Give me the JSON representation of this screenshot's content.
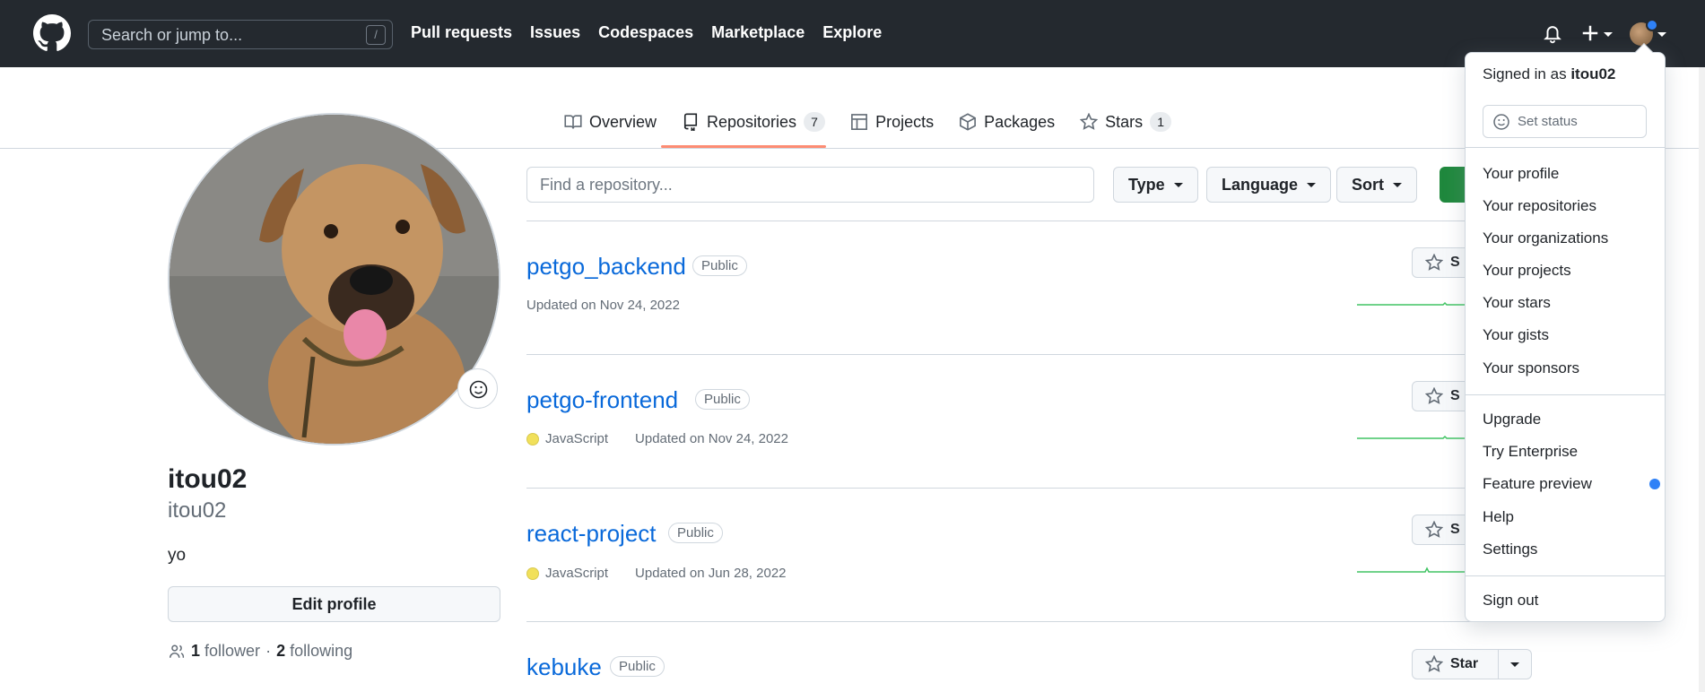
{
  "header": {
    "search_placeholder": "Search or jump to...",
    "search_shortcut": "/",
    "nav": [
      "Pull requests",
      "Issues",
      "Codespaces",
      "Marketplace",
      "Explore"
    ]
  },
  "tabs": [
    {
      "label": "Overview",
      "icon": "book-icon"
    },
    {
      "label": "Repositories",
      "icon": "repo-icon",
      "count": "7"
    },
    {
      "label": "Projects",
      "icon": "table-icon"
    },
    {
      "label": "Packages",
      "icon": "package-icon"
    },
    {
      "label": "Stars",
      "icon": "star-icon",
      "count": "1"
    }
  ],
  "profile": {
    "name": "itou02",
    "login": "itou02",
    "bio": "yo",
    "edit_label": "Edit profile",
    "followers": "1",
    "followers_label": "follower",
    "sep": "·",
    "following": "2",
    "following_label": "following"
  },
  "repo_filter": {
    "placeholder": "Find a repository...",
    "type": "Type",
    "language": "Language",
    "sort": "Sort"
  },
  "repos": [
    {
      "name": "petgo_backend",
      "visibility": "Public",
      "language": "",
      "updated": "Updated on Nov 24, 2022"
    },
    {
      "name": "petgo-frontend",
      "visibility": "Public",
      "language": "JavaScript",
      "updated": "Updated on Nov 24, 2022"
    },
    {
      "name": "react-project",
      "visibility": "Public",
      "language": "JavaScript",
      "updated": "Updated on Jun 28, 2022"
    },
    {
      "name": "kebuke",
      "visibility": "Public",
      "language": "",
      "updated": ""
    }
  ],
  "star_label": "Star",
  "star_label_partial": "S",
  "user_menu": {
    "signed_in_prefix": "Signed in as",
    "username": "itou02",
    "set_status": "Set status",
    "group1": [
      "Your profile",
      "Your repositories",
      "Your organizations",
      "Your projects",
      "Your stars",
      "Your gists",
      "Your sponsors"
    ],
    "group2": [
      "Upgrade",
      "Try Enterprise",
      "Feature preview",
      "Help",
      "Settings"
    ],
    "sign_out": "Sign out"
  },
  "colors": {
    "header_bg": "#24292f",
    "link": "#0969da",
    "accent_underline": "#fd8c73",
    "javascript": "#f1e05a",
    "notification_dot": "#2f81f7",
    "new_button": "#1f883d"
  }
}
